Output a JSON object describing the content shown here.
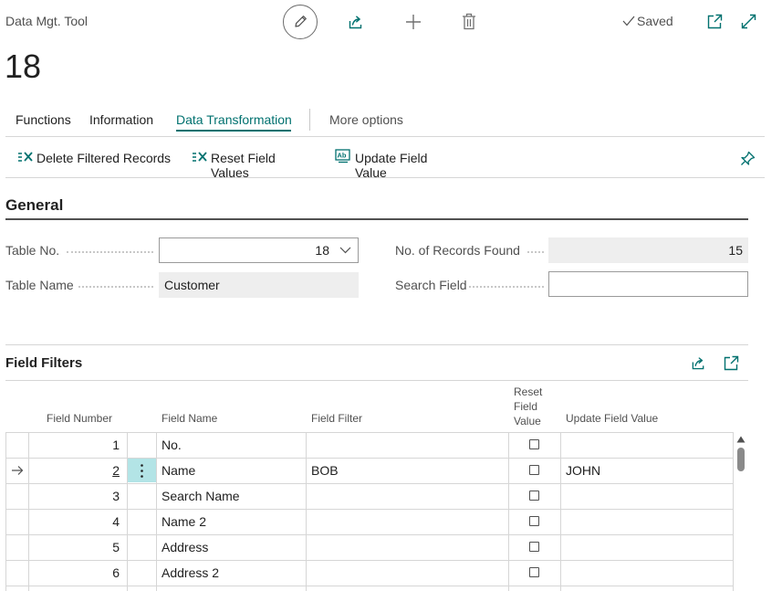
{
  "header": {
    "app_title": "Data Mgt. Tool",
    "record_number": "18",
    "saved_label": "Saved"
  },
  "tabs": [
    {
      "label": "Functions"
    },
    {
      "label": "Information"
    },
    {
      "label": "Data Transformation",
      "active": true
    },
    {
      "label": "More options"
    }
  ],
  "actions": {
    "delete_filtered": "Delete Filtered Records",
    "reset_field_values": "Reset Field Values",
    "update_field_value": "Update Field Value"
  },
  "general": {
    "title": "General",
    "table_no_label": "Table No.",
    "table_no_value": "18",
    "table_name_label": "Table Name",
    "table_name_value": "Customer",
    "records_found_label": "No. of Records Found",
    "records_found_value": "15",
    "search_field_label": "Search Field",
    "search_field_value": ""
  },
  "field_filters": {
    "title": "Field Filters",
    "columns": {
      "field_number": "Field Number",
      "field_name": "Field Name",
      "field_filter": "Field Filter",
      "reset_line1": "Reset",
      "reset_line2": "Field",
      "reset_line3": "Value",
      "update_field_value": "Update Field Value"
    },
    "rows": [
      {
        "field_number": "1",
        "field_name": "No.",
        "field_filter": "",
        "reset": false,
        "update_value": ""
      },
      {
        "field_number": "2",
        "field_name": "Name",
        "field_filter": "BOB",
        "reset": false,
        "update_value": "JOHN",
        "selected": true
      },
      {
        "field_number": "3",
        "field_name": "Search Name",
        "field_filter": "",
        "reset": false,
        "update_value": ""
      },
      {
        "field_number": "4",
        "field_name": "Name 2",
        "field_filter": "",
        "reset": false,
        "update_value": ""
      },
      {
        "field_number": "5",
        "field_name": "Address",
        "field_filter": "",
        "reset": false,
        "update_value": ""
      },
      {
        "field_number": "6",
        "field_name": "Address 2",
        "field_filter": "",
        "reset": false,
        "update_value": ""
      }
    ]
  },
  "colors": {
    "accent": "#00716f",
    "selected_cell": "#b3e4e6",
    "readonly_bg": "#eeeeee"
  },
  "icons": [
    "edit-icon",
    "share-icon",
    "add-icon",
    "delete-icon",
    "checkmark-icon",
    "open-new-window-icon",
    "expand-icon",
    "delete-filtered-icon",
    "reset-fields-icon",
    "update-field-icon",
    "pin-icon",
    "row-arrow-icon",
    "row-menu-icon",
    "chevron-down-icon",
    "scroll-up-icon"
  ]
}
